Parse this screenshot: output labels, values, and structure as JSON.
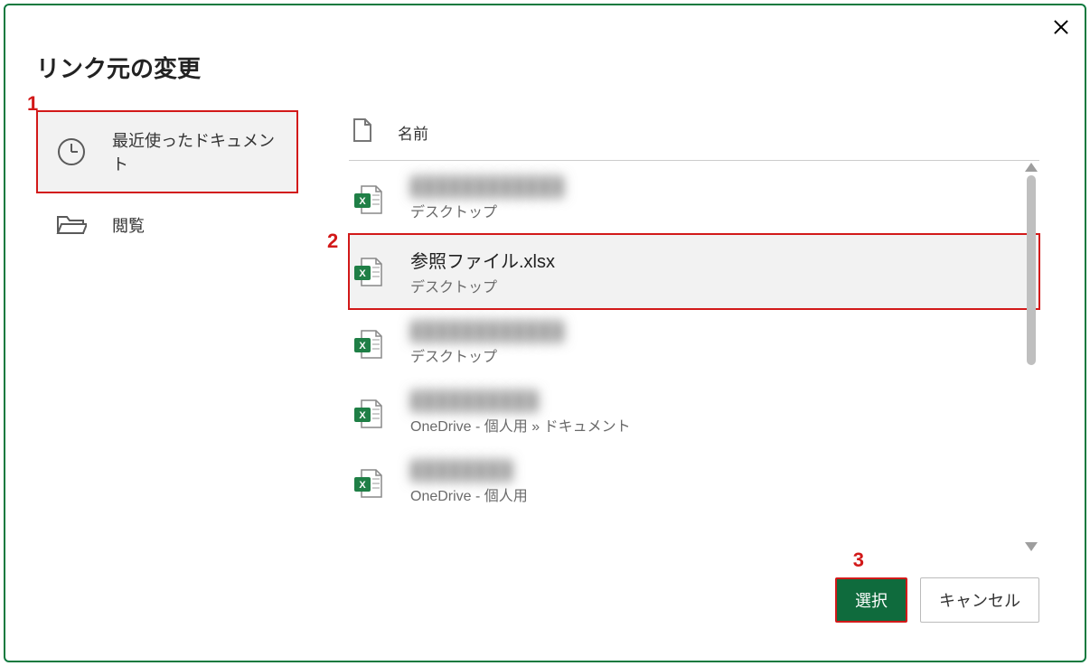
{
  "dialog": {
    "title": "リンク元の変更"
  },
  "sidebar": {
    "items": [
      {
        "label": "最近使ったドキュメント",
        "selected": true
      },
      {
        "label": "閲覧",
        "selected": false
      }
    ]
  },
  "list": {
    "header_name": "名前",
    "files": [
      {
        "name": "████████████",
        "blurred": true,
        "location": "デスクトップ",
        "selected": false
      },
      {
        "name": "参照ファイル.xlsx",
        "blurred": false,
        "location": "デスクトップ",
        "selected": true
      },
      {
        "name": "████████████",
        "blurred": true,
        "location": "デスクトップ",
        "selected": false
      },
      {
        "name": "██████████",
        "blurred": true,
        "location": "OneDrive - 個人用 » ドキュメント",
        "selected": false
      },
      {
        "name": "████████",
        "blurred": true,
        "location": "OneDrive - 個人用",
        "selected": false
      }
    ]
  },
  "buttons": {
    "select_label": "選択",
    "cancel_label": "キャンセル"
  },
  "annotations": {
    "a1": "1",
    "a2": "2",
    "a3": "3"
  }
}
